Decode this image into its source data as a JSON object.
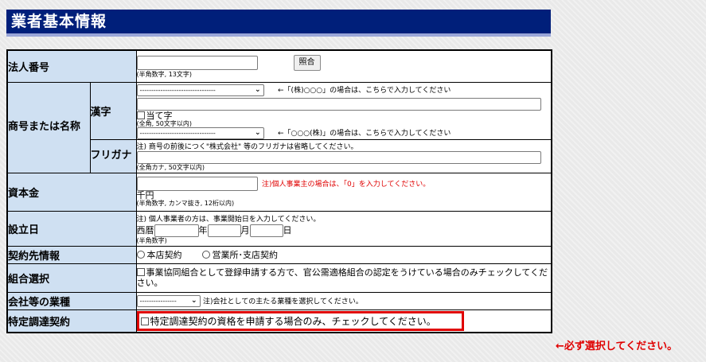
{
  "header": {
    "title": "業者基本情報"
  },
  "corp_number": {
    "label": "法人番号",
    "value": "",
    "button": "照合",
    "hint": "(半角数字, 13文字)"
  },
  "trade_name": {
    "label": "商号または名称",
    "kanji": {
      "label": "漢字",
      "prefix_select": "---------------------------------",
      "prefix_note": "←「(株)○○○」の場合は、こちらで入力してください",
      "name_value": "",
      "ateji_label": "当て字",
      "hint": "(全角, 50文字以内)",
      "suffix_select": "---------------------------------",
      "suffix_note": "←「○○○(株)」の場合は、こちらで入力してください"
    },
    "furigana": {
      "label": "フリガナ",
      "note": "注) 商号の前後につく\"株式会社\" 等のフリガナは省略してください。",
      "value": "",
      "hint": "(全角カナ, 50文字以内)"
    }
  },
  "capital": {
    "label": "資本金",
    "value": "",
    "note": "注)個人事業主の場合は、「0」を入力してください。",
    "unit": "千円",
    "hint": "(半角数字, カンマ抜き, 12桁以内)"
  },
  "established": {
    "label": "設立日",
    "note": "注) 個人事業者の方は、事業開始日を入力してください。",
    "era": "西暦",
    "year_unit": "年",
    "month_unit": "月",
    "day_unit": "日",
    "hint": "(半角数字)"
  },
  "contract_info": {
    "label": "契約先情報",
    "options": [
      "本店契約",
      "営業所･支店契約"
    ]
  },
  "union": {
    "label": "組合選択",
    "text": "事業協同組合として登録申請する方で、官公需適格組合の認定をうけている場合のみチェックしてください。"
  },
  "industry": {
    "label": "会社等の業種",
    "select": "----------------",
    "note": "注)会社としての主たる業種を選択してください。"
  },
  "specific": {
    "label": "特定調達契約",
    "text": "特定調達契約の資格を申請する場合のみ、チェックしてください。",
    "side_note": "←必ず選択してください。"
  },
  "colors": {
    "header_bg": "#001f7a",
    "label_bg": "#cfe0f2",
    "alert": "#e00000"
  }
}
